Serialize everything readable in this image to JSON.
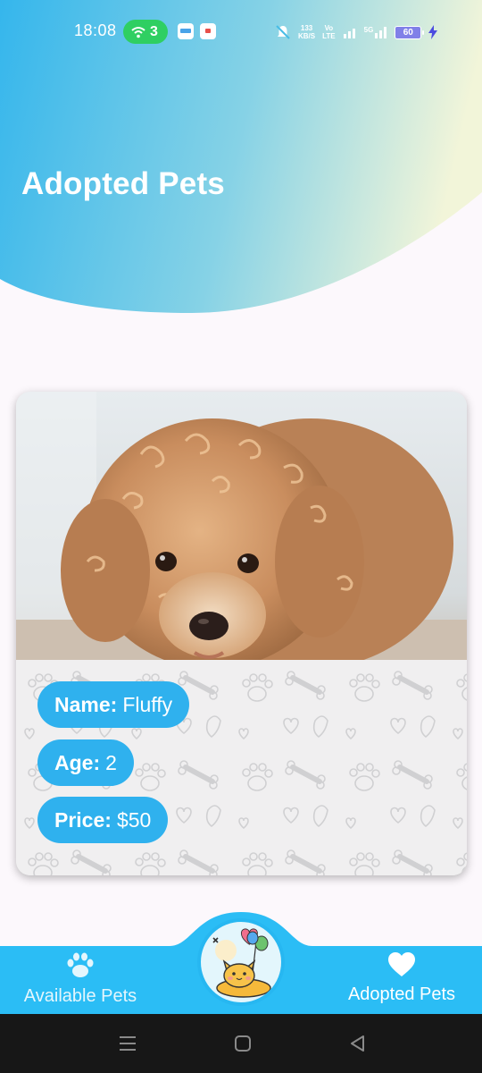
{
  "status_bar": {
    "time": "18:08",
    "hotspot_count": "3",
    "net_speed_value": "133",
    "net_speed_unit": "KB/S",
    "volte_top": "Vo",
    "volte_bottom": "LTE",
    "network_type": "5G",
    "battery_level": "60",
    "icons": [
      "wifi-hotspot-icon",
      "bell-muted-icon",
      "signal-icon",
      "charging-icon"
    ]
  },
  "header": {
    "title": "Adopted Pets",
    "gradient_colors": [
      "#35b6ec",
      "#7ccee8",
      "#f2f5d9"
    ]
  },
  "pet": {
    "name_label": "Name:",
    "name_value": "Fluffy",
    "age_label": "Age:",
    "age_value": "2",
    "price_label": "Price:",
    "price_value": "$50",
    "chip_color": "#2fb1ee"
  },
  "bottom_nav": {
    "left_label": "Available Pets",
    "left_icon": "paw-icon",
    "right_label": "Adopted Pets",
    "right_icon": "heart-icon",
    "center_icon": "cat-with-balloons-icon",
    "bar_color": "#2bbdf5"
  },
  "system_nav": {
    "buttons": [
      "menu-icon",
      "home-icon",
      "back-icon"
    ]
  }
}
